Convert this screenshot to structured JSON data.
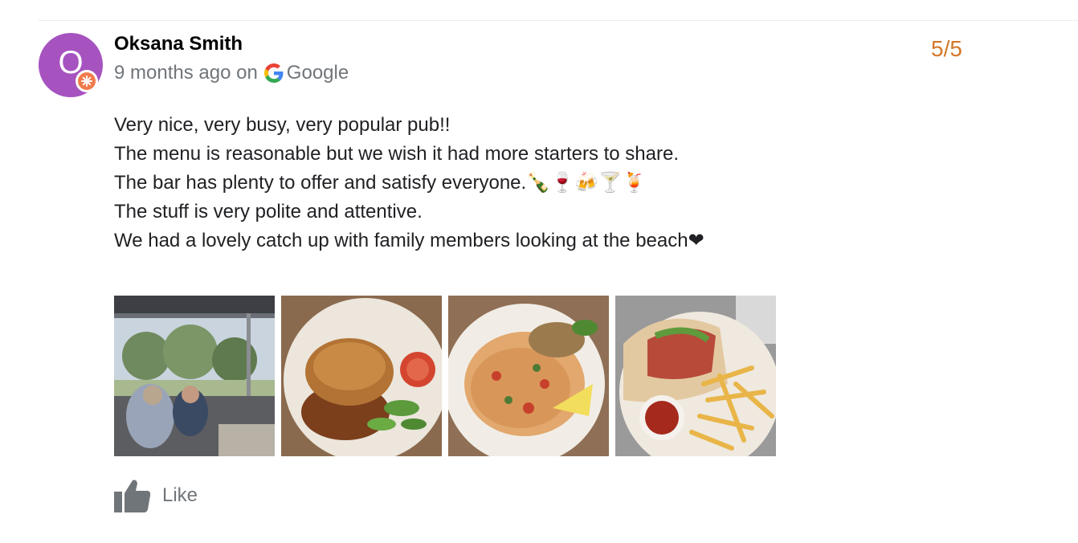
{
  "review": {
    "reviewer": {
      "initial": "O",
      "name": "Oksana Smith",
      "avatar_color": "#a653c0",
      "badge_color": "#f27b4c"
    },
    "time_ago": "9 months ago on",
    "source": "Google",
    "rating": "5/5",
    "rating_color": "#d3782b",
    "text_lines": [
      "Very nice, very busy, very popular pub!!",
      "The menu is reasonable but we wish it had more starters to share.",
      "The bar has plenty to offer and satisfy everyone.🍾🍷🍻🍸🍹",
      "The stuff is very polite and attentive.",
      "We had a lovely catch up with family members looking at the beach❤"
    ],
    "photos": [
      {
        "icon": "pub-terrace-photo"
      },
      {
        "icon": "pie-dish-photo"
      },
      {
        "icon": "seafood-pasta-photo"
      },
      {
        "icon": "wrap-and-chips-photo"
      }
    ],
    "like_label": "Like"
  }
}
